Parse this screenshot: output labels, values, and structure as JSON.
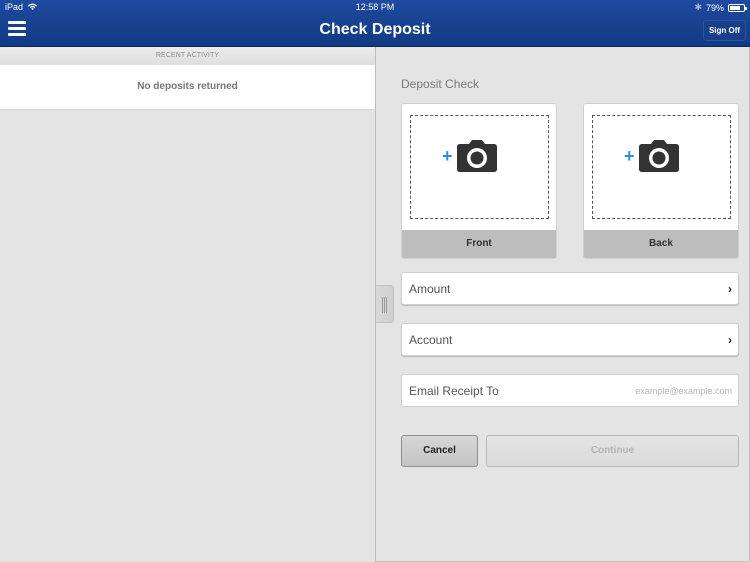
{
  "status_bar": {
    "device": "iPad",
    "time": "12:58 PM",
    "battery_percent_label": "79%",
    "battery_level": 0.79,
    "bluetooth_glyph": "✱"
  },
  "nav": {
    "title": "Check Deposit",
    "menu_icon": "hamburger-menu-icon",
    "sign_off_label": "Sign Off",
    "brand_color": "#1a4391"
  },
  "left_pane": {
    "section_header": "RECENT ACTIVITY",
    "empty_message": "No deposits returned"
  },
  "right_pane": {
    "title": "Deposit Check",
    "capture_cards": [
      {
        "label": "Front",
        "icon": "add-photo-camera-icon"
      },
      {
        "label": "Back",
        "icon": "add-photo-camera-icon"
      }
    ],
    "fields": {
      "amount": {
        "label": "Amount",
        "chevron": "›"
      },
      "account": {
        "label": "Account",
        "chevron": "›"
      },
      "email": {
        "label": "Email Receipt To",
        "value": "",
        "placeholder": "example@example.com"
      }
    },
    "buttons": {
      "cancel": "Cancel",
      "continue": "Continue"
    },
    "accent_color": "#2b8fe0"
  }
}
